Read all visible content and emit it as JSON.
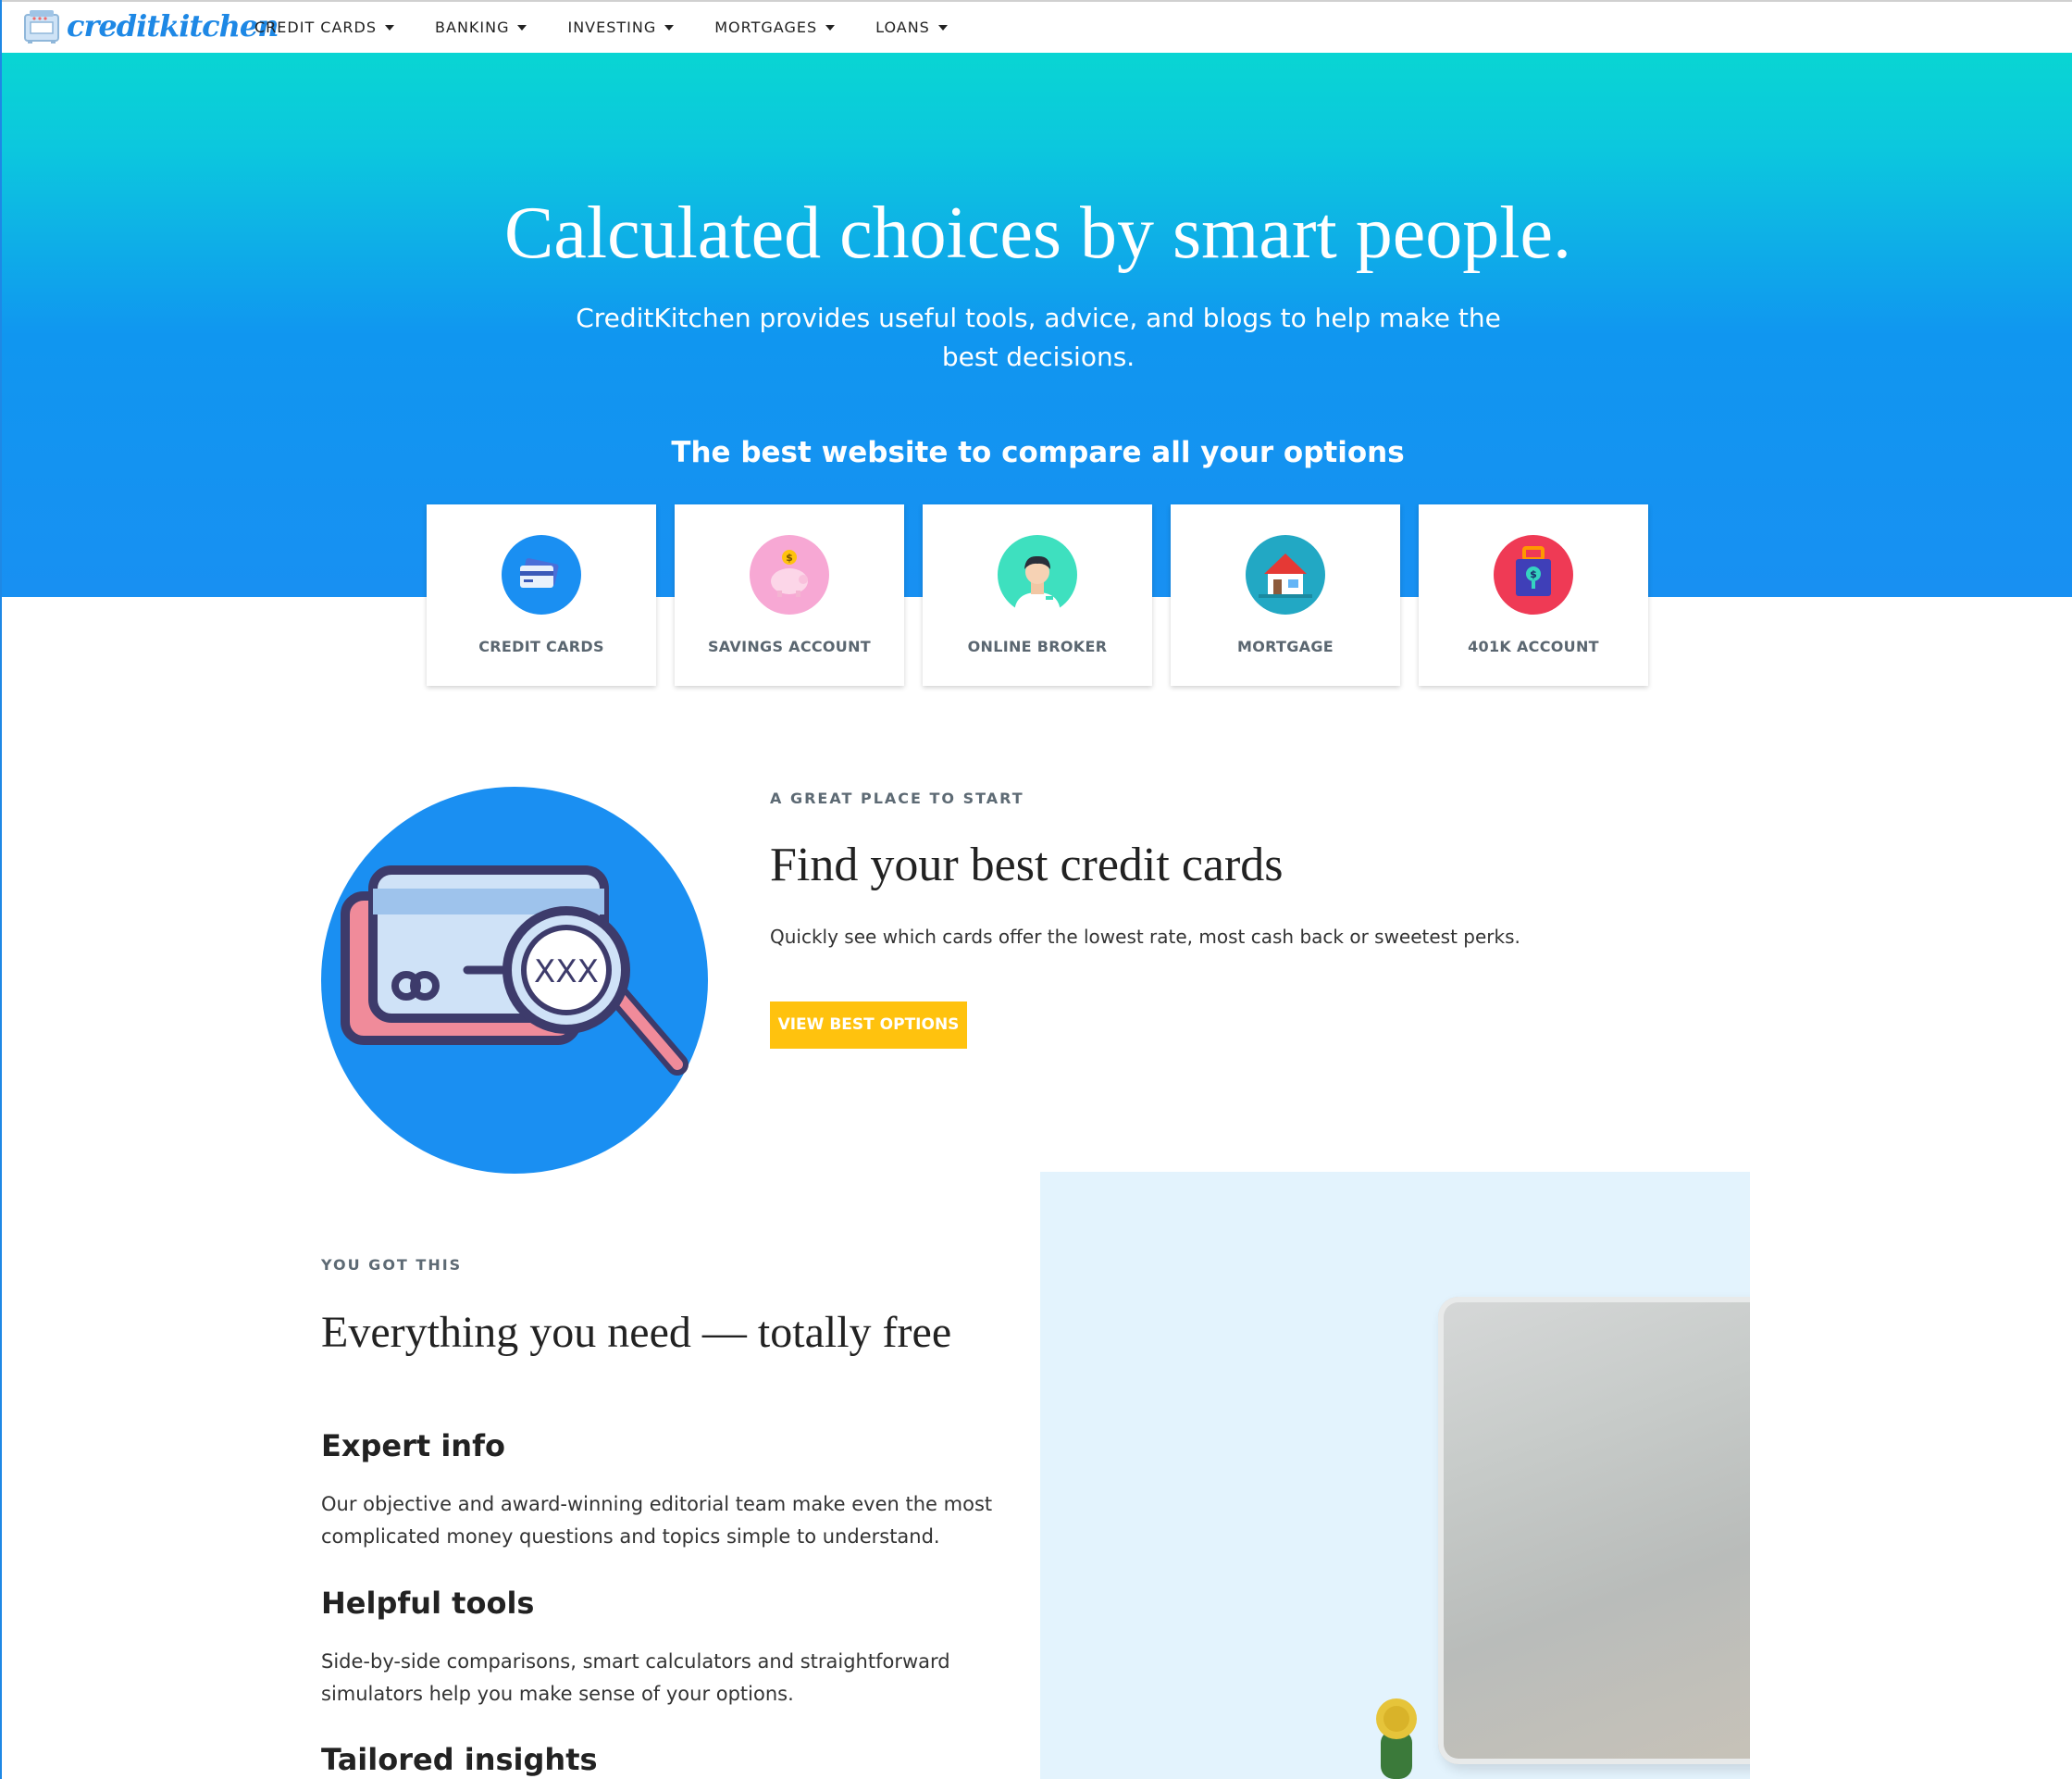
{
  "brand": {
    "name": "creditkitchen"
  },
  "nav": {
    "items": [
      "CREDIT CARDS",
      "BANKING",
      "INVESTING",
      "MORTGAGES",
      "LOANS"
    ]
  },
  "hero": {
    "title": "Calculated choices by smart people.",
    "subtitle": "CreditKitchen provides useful tools, advice, and blogs to help make the best decisions.",
    "tagline": "The best website to compare all your options"
  },
  "categories": [
    {
      "label": "CREDIT CARDS",
      "icon": "credit-card-icon",
      "color": "#1a8ff2"
    },
    {
      "label": "SAVINGS ACCOUNT",
      "icon": "piggy-bank-icon",
      "color": "#f7a8d4"
    },
    {
      "label": "ONLINE BROKER",
      "icon": "broker-avatar-icon",
      "color": "#3ee0bf"
    },
    {
      "label": "MORTGAGE",
      "icon": "house-icon",
      "color": "#22a8c4"
    },
    {
      "label": "401K ACCOUNT",
      "icon": "money-bag-icon",
      "color": "#ef3a55"
    }
  ],
  "feature": {
    "eyebrow": "A GREAT PLACE TO START",
    "title": "Find your best credit cards",
    "description": "Quickly see which cards offer the lowest rate, most cash back or sweetest perks.",
    "cta": "VIEW BEST OPTIONS",
    "illustration_text": "XXX"
  },
  "section2": {
    "eyebrow": "YOU GOT THIS",
    "title": "Everything you need — totally free",
    "items": [
      {
        "title": "Expert info",
        "text": "Our objective and award-winning editorial team make even the most complicated money questions and topics simple to understand."
      },
      {
        "title": "Helpful tools",
        "text": "Side-by-side comparisons, smart calculators and straightforward simulators help you make sense of your options."
      },
      {
        "title": "Tailored insights",
        "text": ""
      }
    ]
  },
  "colors": {
    "accent": "#1e88e5",
    "cta": "#ffc20e",
    "hero_top": "#09d5d3",
    "hero_bottom": "#1890f2"
  }
}
